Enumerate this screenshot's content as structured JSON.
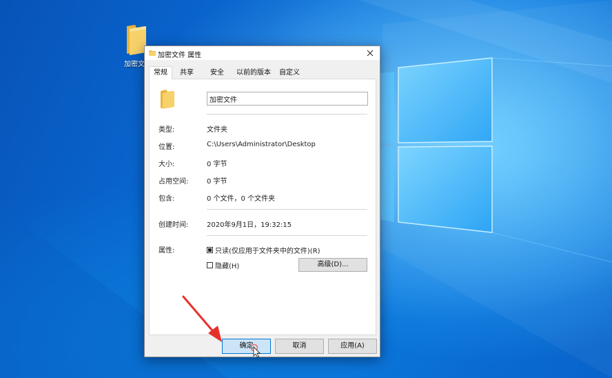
{
  "desktop": {
    "icon_label": "加密文"
  },
  "dialog": {
    "title": "加密文件 属性",
    "tabs": [
      "常规",
      "共享",
      "安全",
      "以前的版本",
      "自定义"
    ],
    "name_value": "加密文件",
    "type_label": "类型:",
    "type_value": "文件夹",
    "location_label": "位置:",
    "location_value": "C:\\Users\\Administrator\\Desktop",
    "size_label": "大小:",
    "size_value": "0 字节",
    "disk_size_label": "占用空间:",
    "disk_size_value": "0 字节",
    "contains_label": "包含:",
    "contains_value": "0 个文件，0 个文件夹",
    "created_label": "创建时间:",
    "created_value": "2020年9月1日，19:32:15",
    "attributes_label": "属性:",
    "readonly_label": "只读(仅应用于文件夹中的文件)(R)",
    "readonly_checked": true,
    "hidden_label": "隐藏(H)",
    "hidden_checked": false,
    "advanced_label": "高级(D)...",
    "ok_label": "确定",
    "cancel_label": "取消",
    "apply_label": "应用(A)"
  },
  "colors": {
    "desktop_blue": "#0b6fd8",
    "folder_yellow": "#f5c84c",
    "accent_blue": "#0078d7",
    "annotation_red": "#e8302a"
  }
}
